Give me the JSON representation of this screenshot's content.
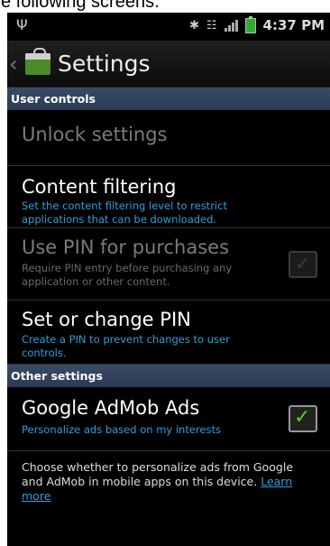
{
  "caption": "e following screens.",
  "status_bar": {
    "time": "4:37 PM",
    "usb_icon": "usb-icon",
    "bluetooth_icon": "bluetooth-icon",
    "wifi_icon": "wifi-icon",
    "signal_icon": "signal-icon",
    "battery_icon": "battery-icon"
  },
  "title_bar": {
    "title": "Settings",
    "back_icon": "chevron-left-icon",
    "app_icon": "market-bag-icon"
  },
  "sections": {
    "user_controls": {
      "header": "User controls",
      "unlock": {
        "title": "Unlock settings"
      },
      "content_filtering": {
        "title": "Content filtering",
        "summary": "Set the content filtering level to restrict applications that can be downloaded."
      },
      "use_pin": {
        "title": "Use PIN for purchases",
        "summary": "Require PIN entry before purchasing any application or other content.",
        "checked": true,
        "enabled": false
      },
      "set_pin": {
        "title": "Set or change PIN",
        "summary": "Create a PIN to prevent changes to user controls."
      }
    },
    "other_settings": {
      "header": "Other settings",
      "admob": {
        "title": "Google AdMob Ads",
        "summary": "Personalize ads based on my interests",
        "checked": true
      },
      "description": "Choose whether to personalize ads from Google and AdMob in mobile apps on this device.",
      "learn_more": "Learn more"
    }
  },
  "colors": {
    "accent": "#2e9fd8",
    "section_header": "#334460",
    "check": "#4fd32c"
  }
}
